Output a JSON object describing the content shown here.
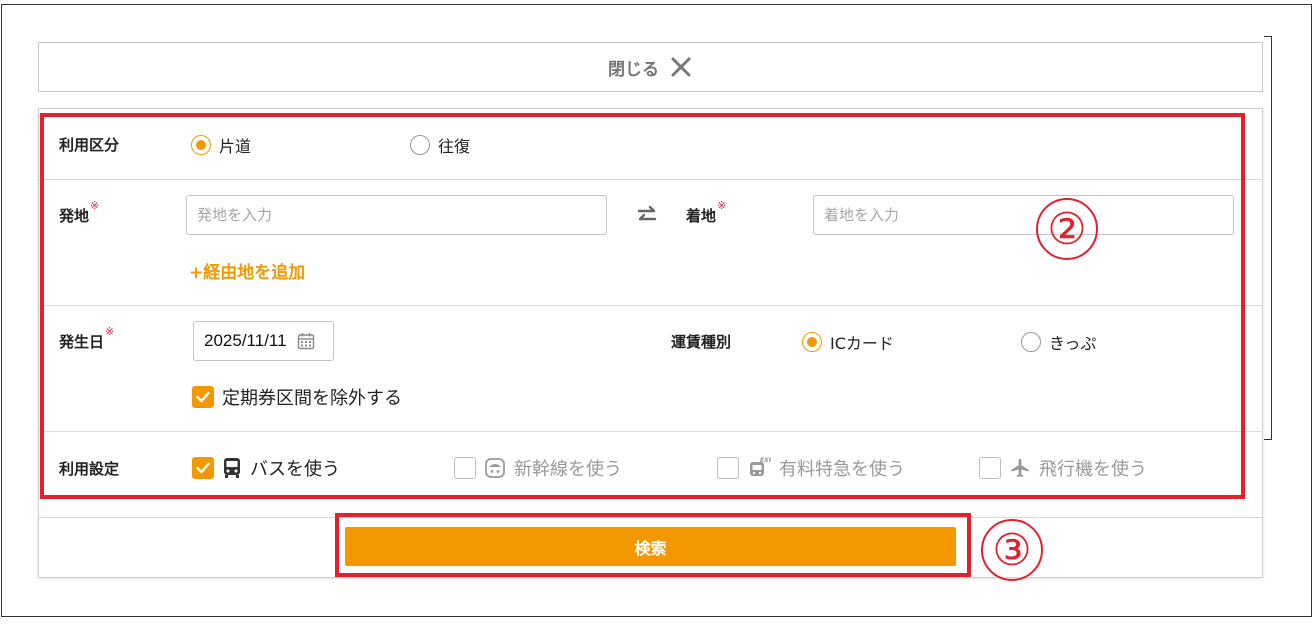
{
  "close_bar": {
    "label": "閉じる"
  },
  "usage_type": {
    "label": "利用区分",
    "options": [
      {
        "label": "片道",
        "selected": true
      },
      {
        "label": "往復",
        "selected": false
      }
    ]
  },
  "route": {
    "origin": {
      "label": "発地",
      "required_mark": "※",
      "placeholder": "発地を入力",
      "value": ""
    },
    "destination": {
      "label": "着地",
      "required_mark": "※",
      "placeholder": "着地を入力",
      "value": ""
    },
    "add_via_label": "+経由地を追加"
  },
  "date": {
    "label": "発生日",
    "required_mark": "※",
    "value": "2025/11/11",
    "exclude_commuter": {
      "label": "定期券区間を除外する",
      "checked": true
    }
  },
  "fare_type": {
    "label": "運賃種別",
    "options": [
      {
        "label": "ICカード",
        "selected": true
      },
      {
        "label": "きっぷ",
        "selected": false
      }
    ]
  },
  "usage_settings": {
    "label": "利用設定",
    "options": [
      {
        "label": "バスを使う",
        "checked": true,
        "icon": "bus-icon"
      },
      {
        "label": "新幹線を使う",
        "checked": false,
        "icon": "shinkansen-icon"
      },
      {
        "label": "有料特急を使う",
        "checked": false,
        "icon": "express-train-icon"
      },
      {
        "label": "飛行機を使う",
        "checked": false,
        "icon": "airplane-icon"
      }
    ]
  },
  "search_button": {
    "label": "検索"
  },
  "annotations": {
    "marker_2": "②",
    "marker_3": "③"
  },
  "colors": {
    "accent": "#f39800",
    "annotation": "#e4202e",
    "required": "#e0245e"
  }
}
